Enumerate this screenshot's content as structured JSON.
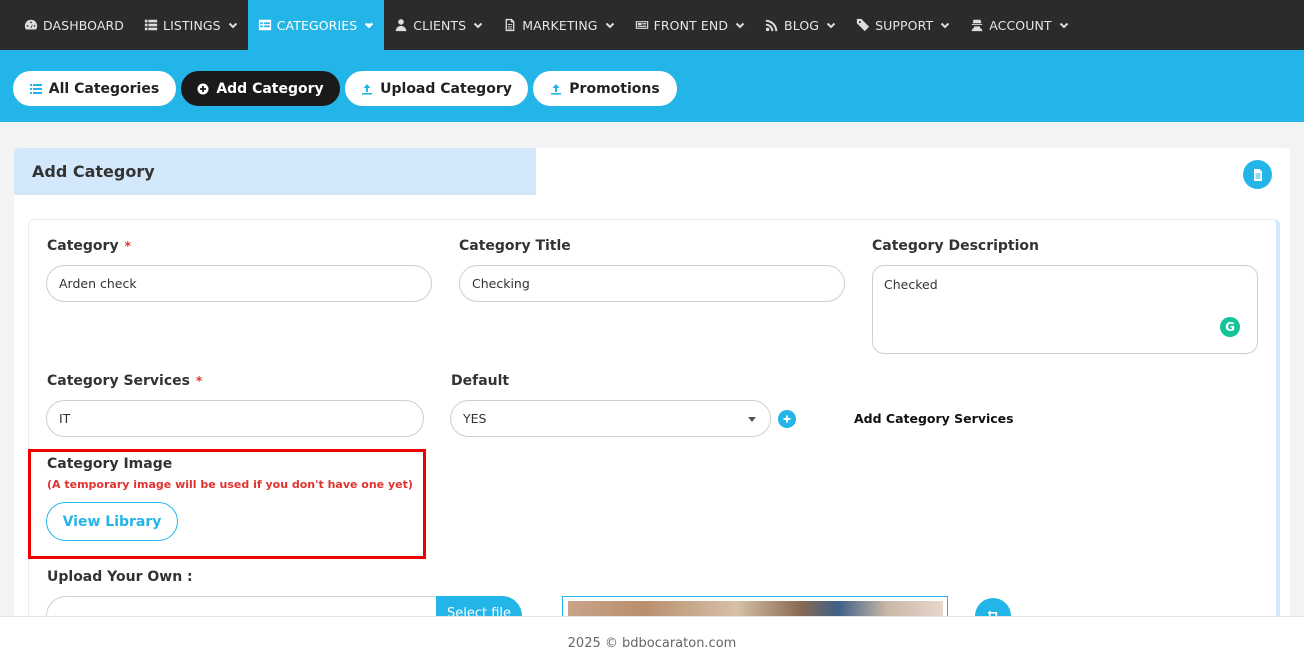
{
  "nav": {
    "items": [
      {
        "label": "DASHBOARD",
        "icon": "dashboard-icon"
      },
      {
        "label": "LISTINGS",
        "icon": "list-icon"
      },
      {
        "label": "CATEGORIES",
        "icon": "table-icon"
      },
      {
        "label": "CLIENTS",
        "icon": "user-icon"
      },
      {
        "label": "MARKETING",
        "icon": "document-icon"
      },
      {
        "label": "FRONT END",
        "icon": "newspaper-icon"
      },
      {
        "label": "BLOG",
        "icon": "rss-icon"
      },
      {
        "label": "SUPPORT",
        "icon": "ticket-icon"
      },
      {
        "label": "ACCOUNT",
        "icon": "user-secret-icon"
      }
    ],
    "active": "CATEGORIES"
  },
  "subnav": {
    "all_categories": "All Categories",
    "add_category": "Add Category",
    "upload_category": "Upload Category",
    "promotions": "Promotions"
  },
  "card": {
    "title": "Add Category"
  },
  "form": {
    "category_label": "Category",
    "category_value": "Arden check",
    "required_mark": "*",
    "title_label": "Category Title",
    "title_value": "Checking",
    "description_label": "Category Description",
    "description_value": "Checked",
    "services_label": "Category Services",
    "services_value": "IT",
    "default_label": "Default",
    "default_value": "YES",
    "add_services_label": "Add Category Services",
    "image_label": "Category Image",
    "image_note": "(A temporary image will be used if you don't have one yet)",
    "view_library": "View Library",
    "upload_label": "Upload Your Own :",
    "select_file": "Select file"
  },
  "footer": {
    "text": "2025 © bdbocaraton.com"
  },
  "colors": {
    "accent": "#23b5e8",
    "nav_bg": "#2b2b2b",
    "header_bg": "#d4e8fb",
    "required": "#e0332f",
    "highlight_box": "#ef0000"
  }
}
